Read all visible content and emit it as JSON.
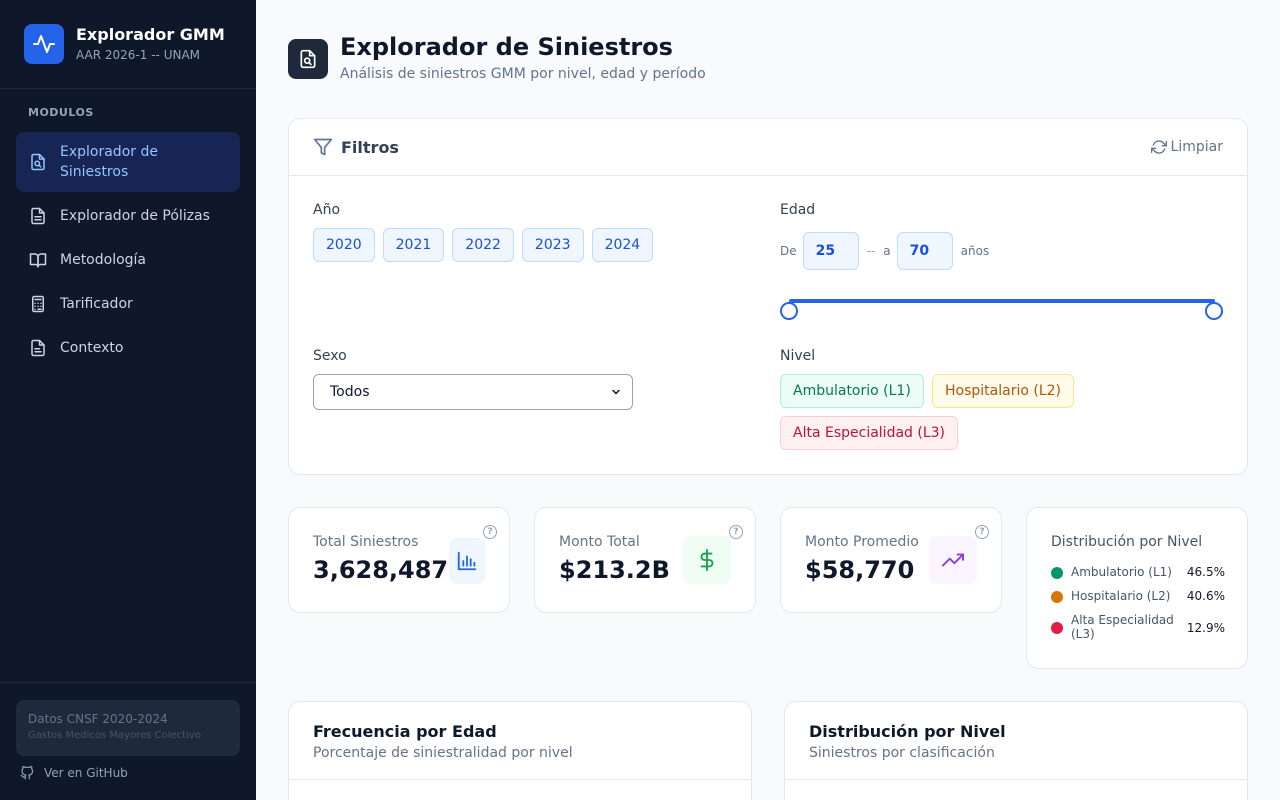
{
  "sidebar": {
    "brand_title": "Explorador GMM",
    "brand_subtitle": "AAR 2026-1 -- UNAM",
    "section_label": "MODULOS",
    "items": [
      {
        "label": "Explorador de Siniestros",
        "icon": "file-search-icon",
        "active": true
      },
      {
        "label": "Explorador de Pólizas",
        "icon": "file-text-icon",
        "active": false
      },
      {
        "label": "Metodología",
        "icon": "book-open-icon",
        "active": false
      },
      {
        "label": "Tarificador",
        "icon": "calculator-icon",
        "active": false
      },
      {
        "label": "Contexto",
        "icon": "file-icon",
        "active": false
      }
    ],
    "data_box_title": "Datos CNSF 2020-2024",
    "data_box_subtitle": "Gastos Medicos Mayores Colectivo",
    "github_label": "Ver en GitHub"
  },
  "header": {
    "title": "Explorador de Siniestros",
    "subtitle": "Análisis de siniestros GMM por nivel, edad y período"
  },
  "filters": {
    "title": "Filtros",
    "clear_label": "Limpiar",
    "year_label": "Año",
    "years": [
      "2020",
      "2021",
      "2022",
      "2023",
      "2024"
    ],
    "age_label": "Edad",
    "age_from_label": "De",
    "age_sep": "--",
    "age_to_label": "a",
    "age_unit": "años",
    "age_min": "25",
    "age_max": "70",
    "sex_label": "Sexo",
    "sex_value": "Todos",
    "level_label": "Nivel",
    "levels": [
      "Ambulatorio (L1)",
      "Hospitalario (L2)",
      "Alta Especialidad (L3)"
    ]
  },
  "kpis": [
    {
      "label": "Total Siniestros",
      "value": "3,628,487",
      "icon": "bar-chart-icon",
      "color": "#2563eb"
    },
    {
      "label": "Monto Total",
      "value": "$213.2B",
      "icon": "dollar-icon",
      "color": "#16a34a"
    },
    {
      "label": "Monto Promedio",
      "value": "$58,770",
      "icon": "trending-up-icon",
      "color": "#9333ea"
    }
  ],
  "distribution": {
    "title": "Distribución por Nivel",
    "rows": [
      {
        "name": "Ambulatorio (L1)",
        "pct": "46.5%",
        "color": "#059669"
      },
      {
        "name": "Hospitalario (L2)",
        "pct": "40.6%",
        "color": "#d97706"
      },
      {
        "name": "Alta Especialidad (L3)",
        "pct": "12.9%",
        "color": "#e11d48"
      }
    ]
  },
  "panels": [
    {
      "title": "Frecuencia por Edad",
      "subtitle": "Porcentaje de siniestralidad por nivel"
    },
    {
      "title": "Distribución por Nivel",
      "subtitle": "Siniestros por clasificación"
    }
  ]
}
